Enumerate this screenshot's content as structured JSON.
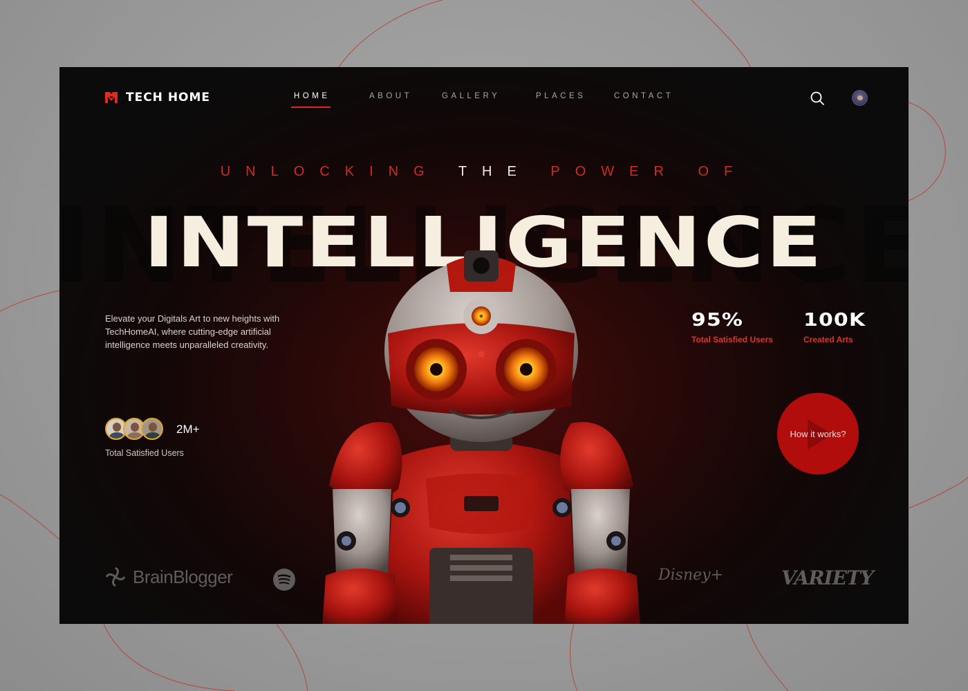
{
  "brand": {
    "name": "TECH HOME"
  },
  "nav": {
    "items": [
      {
        "label": "HOME",
        "active": true
      },
      {
        "label": "ABOUT",
        "active": false
      },
      {
        "label": "GALLERY",
        "active": false
      },
      {
        "label": "PLACES",
        "active": false
      },
      {
        "label": "CONTACT",
        "active": false
      }
    ],
    "search_icon": "search-icon",
    "avatar_icon": "user-avatar"
  },
  "hero": {
    "eyebrow_red": "UNLOCKING",
    "eyebrow_white": "THE",
    "eyebrow_red2": "POWER OF",
    "headline": "INTELLIGENCE",
    "background_word": "INTELLIGENCE",
    "description": "Elevate your Digitals Art to new heights with TechHomeAI, where cutting-edge artificial intelligence meets unparalleled creativity.",
    "users_count": "2M+",
    "users_label": "Total Satisfied Users",
    "cta_label": "How it works?"
  },
  "stats": [
    {
      "value": "95%",
      "label": "Total Satisfied Users"
    },
    {
      "value": "100K",
      "label": "Created Arts"
    }
  ],
  "partners": [
    {
      "name": "BrainBlogger"
    },
    {
      "name": "Spotify"
    },
    {
      "name": "Disney+"
    },
    {
      "name": "VARIETY"
    }
  ],
  "colors": {
    "accent": "#e02a1f",
    "background": "#0b0b0b",
    "headline": "#f6efe0",
    "cta": "#b20d0d"
  }
}
